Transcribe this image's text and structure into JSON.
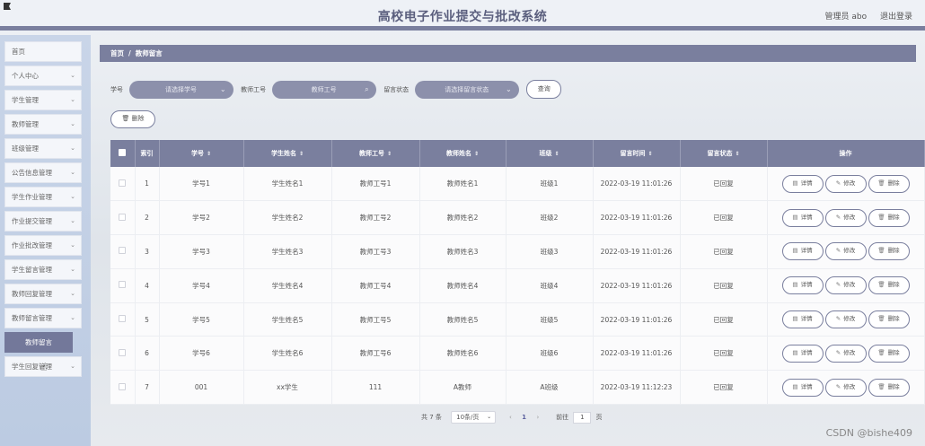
{
  "header": {
    "title": "高校电子作业提交与批改系统",
    "user": "管理员 abo",
    "logout": "退出登录"
  },
  "sidebar": {
    "items": [
      {
        "label": "首页",
        "chevron": false
      },
      {
        "label": "个人中心",
        "chevron": true
      },
      {
        "label": "学生管理",
        "chevron": true
      },
      {
        "label": "教师管理",
        "chevron": true
      },
      {
        "label": "班级管理",
        "chevron": true
      },
      {
        "label": "公告信息管理",
        "chevron": true
      },
      {
        "label": "学生作业管理",
        "chevron": true
      },
      {
        "label": "作业提交管理",
        "chevron": true
      },
      {
        "label": "作业批改管理",
        "chevron": true
      },
      {
        "label": "学生留言管理",
        "chevron": true
      },
      {
        "label": "教师回复管理",
        "chevron": true
      },
      {
        "label": "教师留言管理",
        "chevron": true
      }
    ],
    "active_sub": "教师留言",
    "last_item": "学生回复管理"
  },
  "breadcrumb": {
    "home": "首页",
    "sep": "/",
    "current": "教师留言"
  },
  "filters": {
    "student_no_label": "学号",
    "student_no_placeholder": "请选择学号",
    "teacher_no_label": "教师工号",
    "teacher_no_placeholder": "教师工号",
    "status_label": "留言状态",
    "status_placeholder": "请选择留言状态",
    "query_button": "查询"
  },
  "delete_button": "删除",
  "table": {
    "headers": [
      "索引",
      "学号",
      "学生姓名",
      "教师工号",
      "教师姓名",
      "班级",
      "留言时间",
      "留言状态",
      "操作"
    ],
    "rows": [
      [
        "1",
        "学号1",
        "学生姓名1",
        "教师工号1",
        "教师姓名1",
        "班级1",
        "2022-03-19 11:01:26",
        "已回复"
      ],
      [
        "2",
        "学号2",
        "学生姓名2",
        "教师工号2",
        "教师姓名2",
        "班级2",
        "2022-03-19 11:01:26",
        "已回复"
      ],
      [
        "3",
        "学号3",
        "学生姓名3",
        "教师工号3",
        "教师姓名3",
        "班级3",
        "2022-03-19 11:01:26",
        "已回复"
      ],
      [
        "4",
        "学号4",
        "学生姓名4",
        "教师工号4",
        "教师姓名4",
        "班级4",
        "2022-03-19 11:01:26",
        "已回复"
      ],
      [
        "5",
        "学号5",
        "学生姓名5",
        "教师工号5",
        "教师姓名5",
        "班级5",
        "2022-03-19 11:01:26",
        "已回复"
      ],
      [
        "6",
        "学号6",
        "学生姓名6",
        "教师工号6",
        "教师姓名6",
        "班级6",
        "2022-03-19 11:01:26",
        "已回复"
      ],
      [
        "7",
        "001",
        "xx学生",
        "111",
        "A教师",
        "A班级",
        "2022-03-19 11:12:23",
        "已回复"
      ]
    ],
    "actions": {
      "detail": "详情",
      "edit": "修改",
      "delete": "删除"
    }
  },
  "pagination": {
    "total": "共 7 条",
    "page_size": "10条/页",
    "current_page": "1",
    "goto_label": "前往",
    "goto_value": "1",
    "page_suffix": "页"
  },
  "watermark": "CSDN @bishe409",
  "colors": {
    "accent": "#7a7f9e",
    "input_bg": "#8c90ab",
    "sidebar_bg": "#c9d5e8"
  }
}
